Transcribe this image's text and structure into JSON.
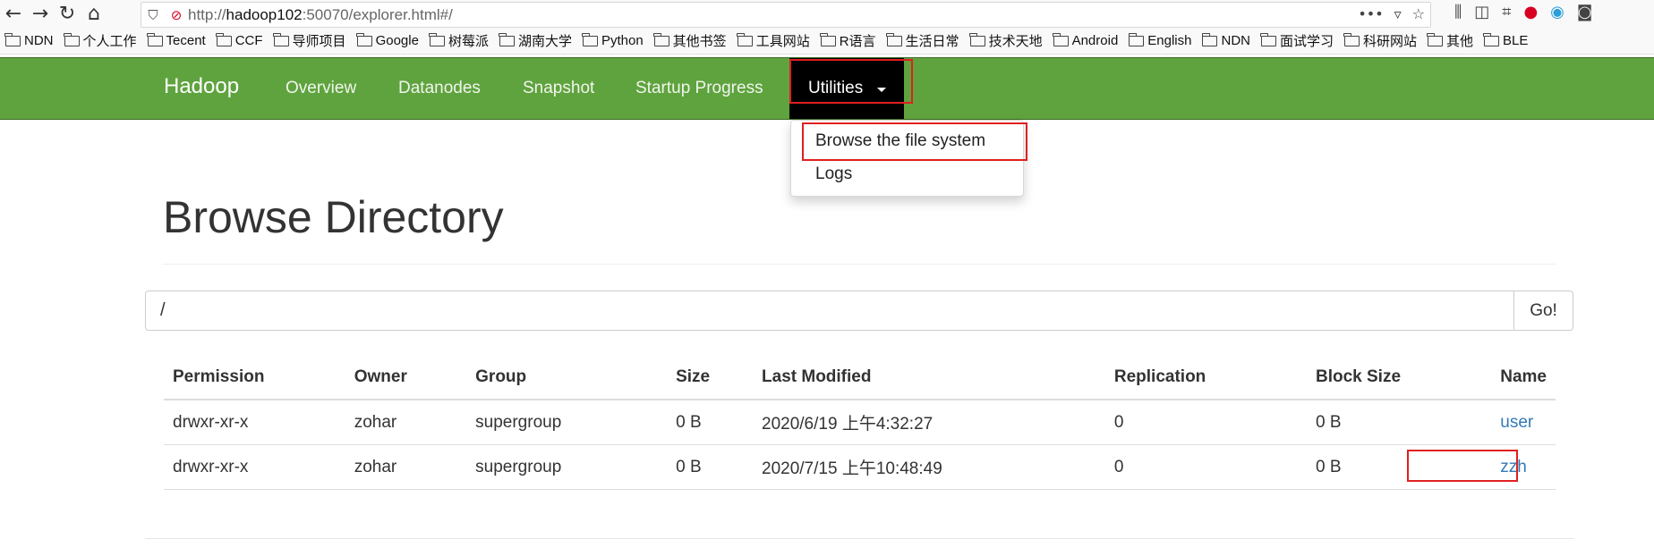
{
  "browser": {
    "url_prefix": "http://",
    "url_host": "hadoop102",
    "url_rest": ":50070/explorer.html#/",
    "bookmarks": [
      "NDN",
      "个人工作",
      "Tecent",
      "CCF",
      "导师项目",
      "Google",
      "树莓派",
      "湖南大学",
      "Python",
      "其他书签",
      "工具网站",
      "R语言",
      "生活日常",
      "技术天地",
      "Android",
      "English",
      "NDN",
      "面试学习",
      "科研网站",
      "其他",
      "BLE"
    ]
  },
  "navbar": {
    "brand": "Hadoop",
    "links": [
      "Overview",
      "Datanodes",
      "Snapshot",
      "Startup Progress"
    ],
    "utilities_label": "Utilities",
    "dropdown": [
      "Browse the file system",
      "Logs"
    ]
  },
  "main": {
    "title": "Browse Directory",
    "path_value": "/",
    "go_label": "Go!",
    "columns": [
      "Permission",
      "Owner",
      "Group",
      "Size",
      "Last Modified",
      "Replication",
      "Block Size",
      "Name"
    ],
    "rows": [
      [
        "drwxr-xr-x",
        "zohar",
        "supergroup",
        "0 B",
        "2020/6/19 上午4:32:27",
        "0",
        "0 B",
        "user"
      ],
      [
        "drwxr-xr-x",
        "zohar",
        "supergroup",
        "0 B",
        "2020/7/15 上午10:48:49",
        "0",
        "0 B",
        "zzh"
      ]
    ]
  },
  "colors": {
    "navbar_green": "#5fa33e",
    "link_blue": "#337ab7",
    "highlight_red": "#e02020"
  }
}
